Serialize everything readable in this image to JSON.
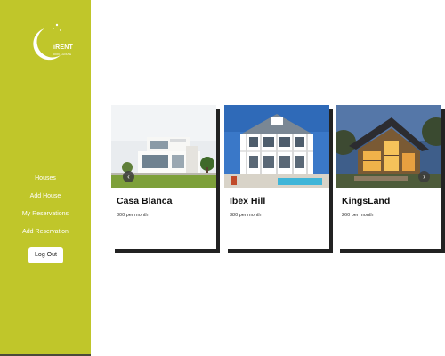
{
  "brand": {
    "name": "iRENT",
    "tagline": "BOOK A HOUSE",
    "accent_color": "#c0c62a"
  },
  "sidebar": {
    "items": [
      {
        "label": "Houses"
      },
      {
        "label": "Add House"
      },
      {
        "label": "My Reservations"
      },
      {
        "label": "Add Reservation"
      }
    ],
    "logout_label": "Log Out"
  },
  "carousel": {
    "prev_icon": "chevron-left-icon",
    "next_icon": "chevron-right-icon",
    "prev_glyph": "‹",
    "next_glyph": "›"
  },
  "houses": [
    {
      "name": "Casa Blanca",
      "price": "300 per month"
    },
    {
      "name": "Ibex Hill",
      "price": "380 per month"
    },
    {
      "name": "KingsLand",
      "price": "260 per month"
    }
  ]
}
